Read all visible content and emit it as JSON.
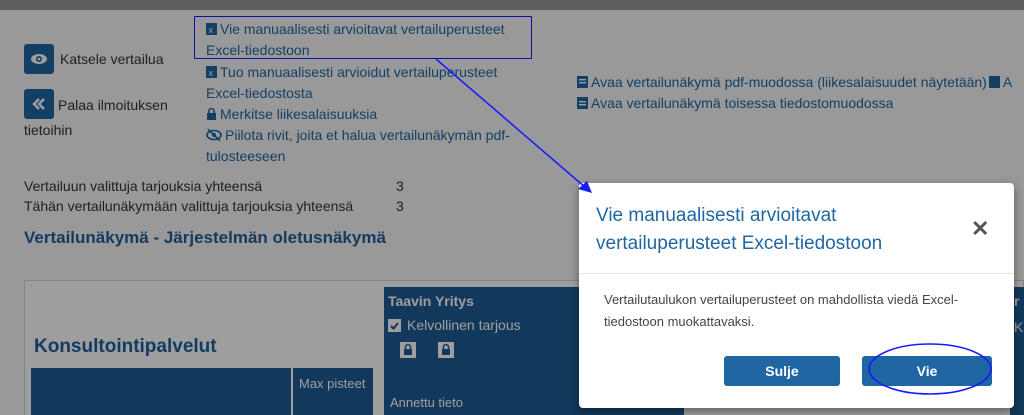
{
  "left_actions": {
    "view_label": "Katsele vertailua",
    "back_label": "Palaa ilmoituksen tietoihin"
  },
  "links": {
    "export_excel": "Vie manuaalisesti arvioitavat vertailuperusteet Excel-tiedostoon",
    "import_excel": "Tuo manuaalisesti arvioidut vertailuperusteet Excel-tiedostosta",
    "mark_secrets": "Merkitse liikesalaisuuksia",
    "hide_rows": "Piilota rivit, joita et halua vertailunäkymän pdf-tulosteeseen",
    "open_pdf": "Avaa vertailunäkymä pdf-muodossa (liikesalaisuudet näytetään)",
    "open_pdf_more": "A",
    "open_other": "Avaa vertailunäkymä toisessa tiedostomuodossa"
  },
  "summary": {
    "row1_label": "Vertailuun valittuja tarjouksia yhteensä",
    "row1_value": "3",
    "row2_label": "Tähän vertailunäkymään valittuja tarjouksia yhteensä",
    "row2_value": "3"
  },
  "section_title": "Vertailunäkymä - Järjestelmän oletusnäkymä",
  "grid": {
    "category": "Konsultointipalvelut",
    "max_points_header": "Max pisteet",
    "supplier_name": "Taavin Yritys",
    "valid_offer": "Kelvollinen tarjous",
    "given_info": "Annettu tieto",
    "right_clip_top": "r",
    "right_clip_mid": "K"
  },
  "modal": {
    "title": "Vie manuaalisesti arvioitavat vertailuperusteet Excel-tiedostoon",
    "body": "Vertailutaulukon vertailuperusteet on mahdollista viedä Excel-tiedostoon muokattavaksi.",
    "close_label": "Sulje",
    "confirm_label": "Vie"
  },
  "colors": {
    "primary": "#1f66a3",
    "header_blue": "#1d5d93",
    "annotation": "#1a1aff"
  },
  "icons": [
    "eye-icon",
    "double-chevron-left-icon",
    "excel-icon",
    "lock-icon",
    "eye-slash-icon",
    "pdf-icon",
    "file-icon",
    "checkbox-icon",
    "close-icon"
  ]
}
